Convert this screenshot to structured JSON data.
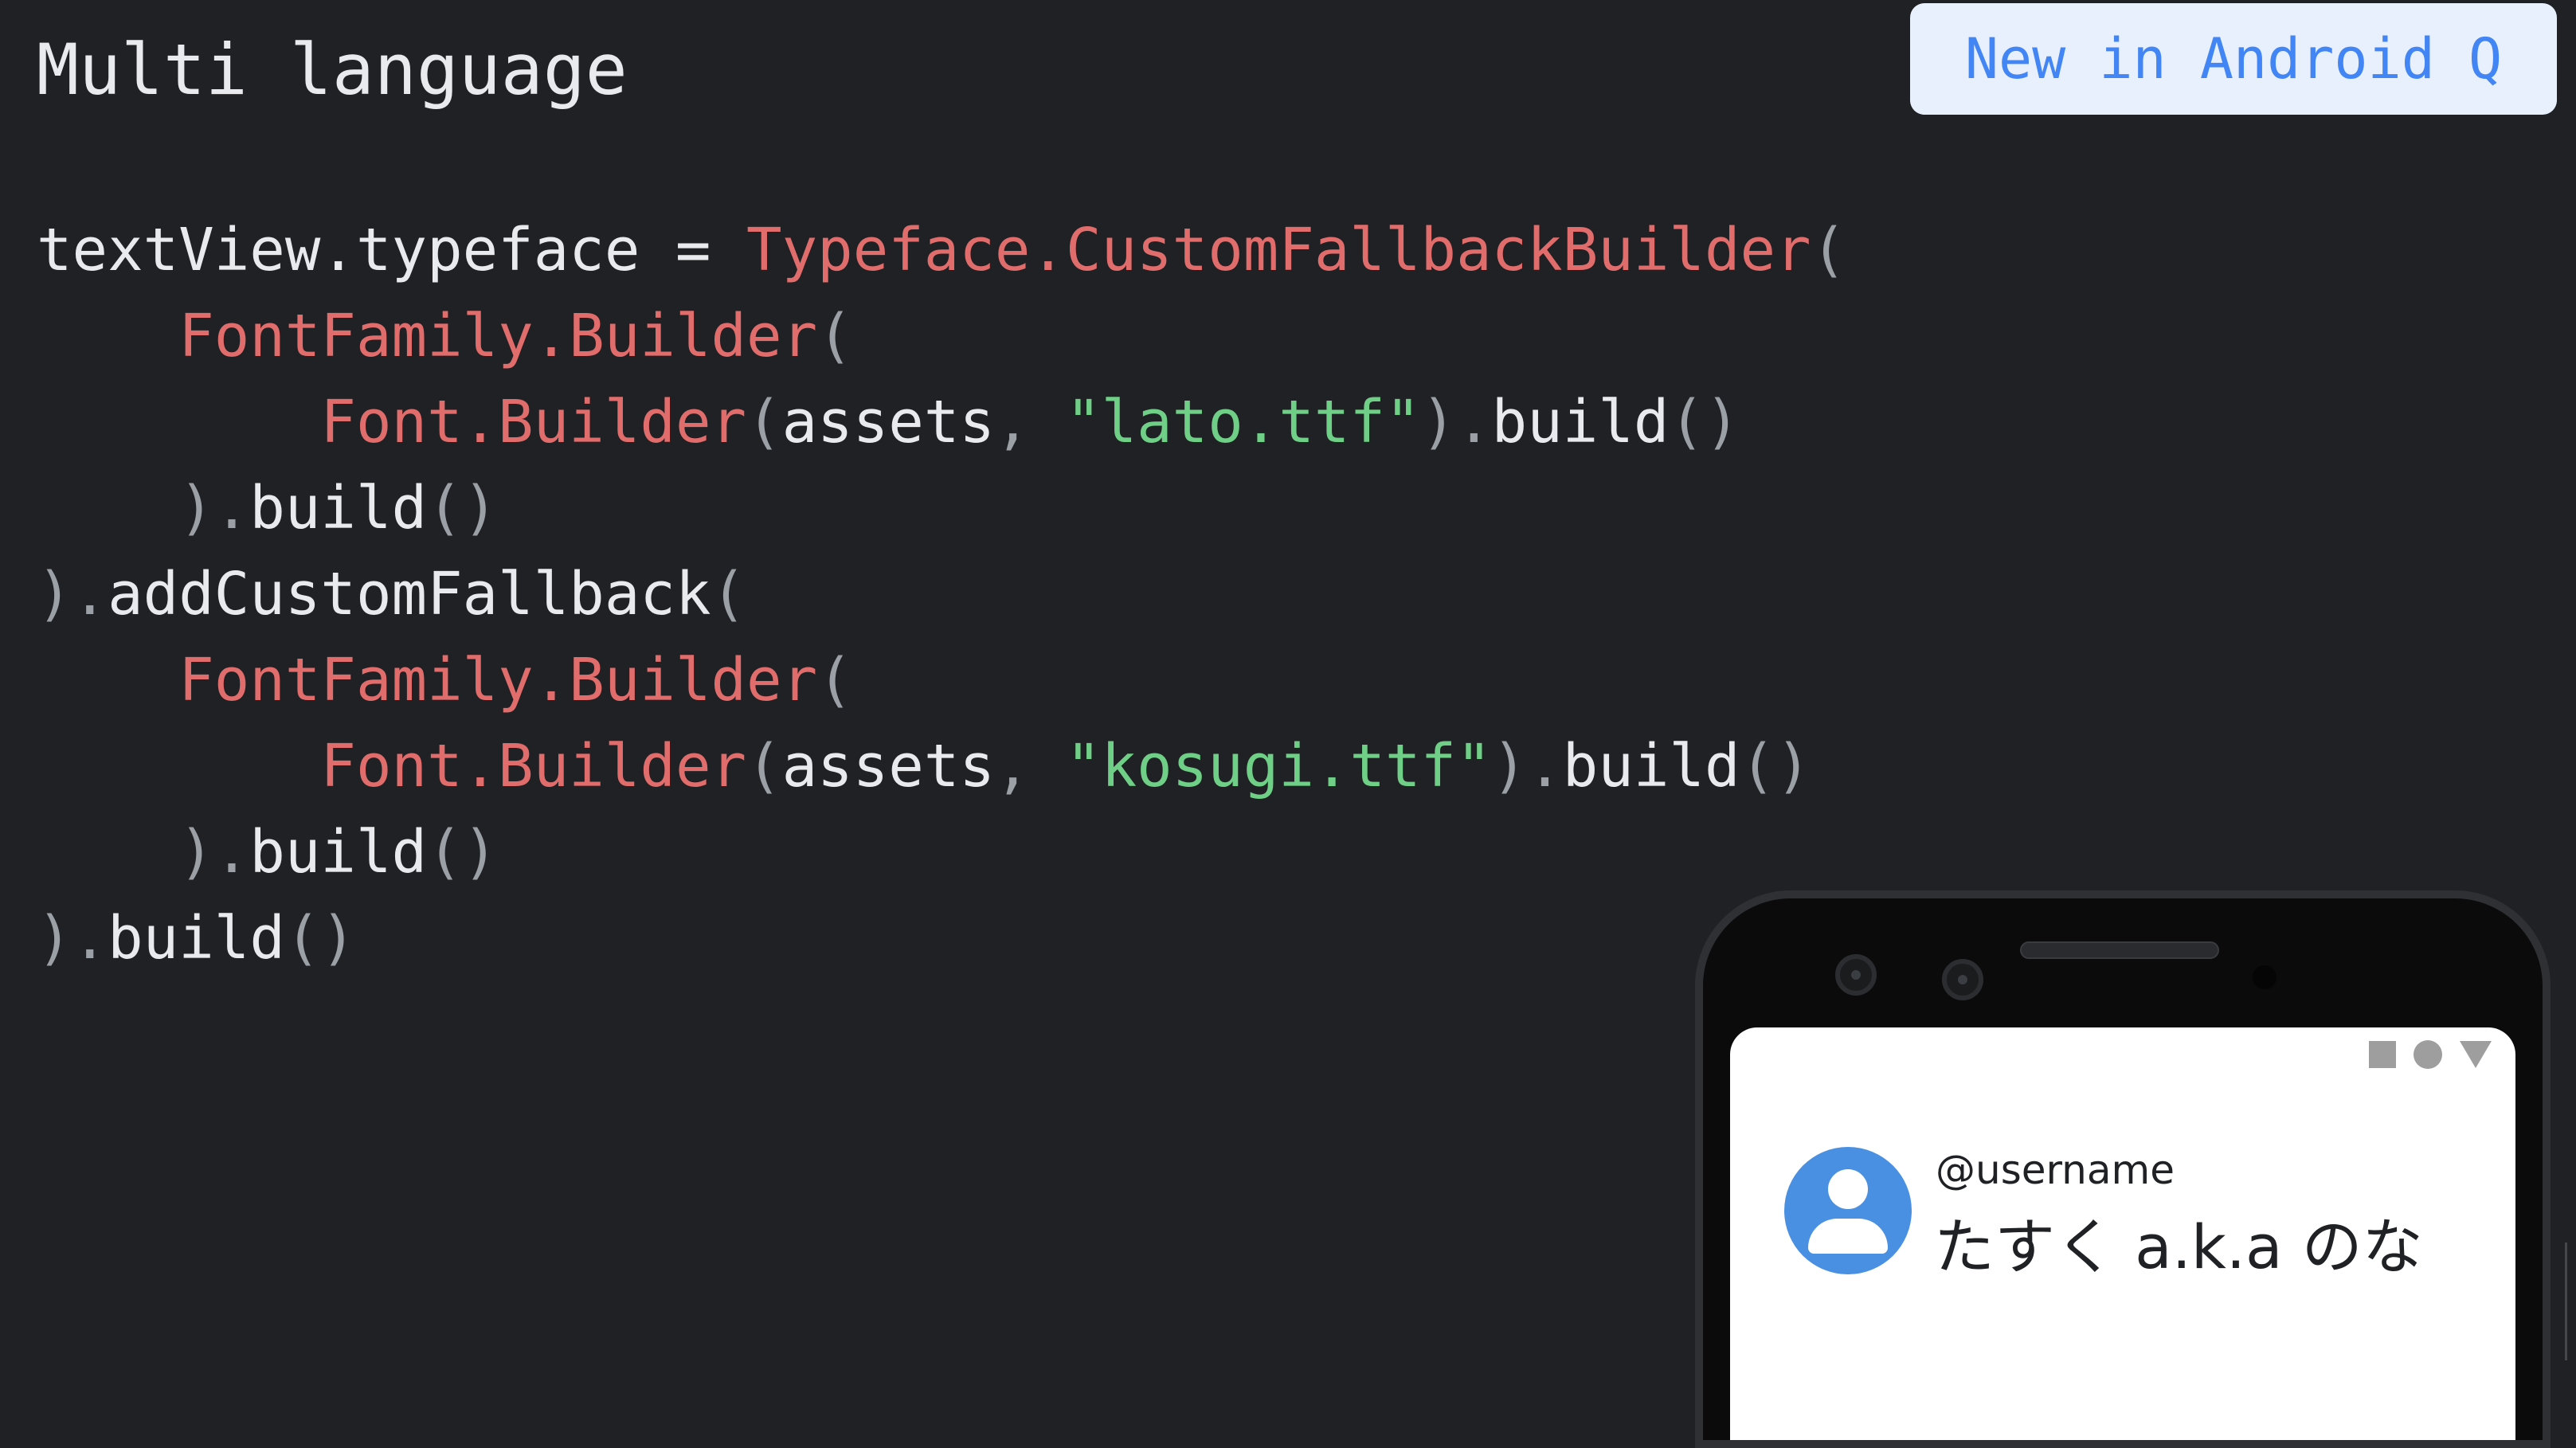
{
  "slide": {
    "title": "Multi language",
    "badge": "New in Android Q"
  },
  "code": {
    "lines": [
      [
        {
          "t": "textView.typeface = ",
          "k": "txt"
        },
        {
          "t": "Typeface.CustomFallbackBuilder",
          "k": "cls"
        },
        {
          "t": "(",
          "k": "pun"
        }
      ],
      [
        {
          "t": "    ",
          "k": "txt"
        },
        {
          "t": "FontFamily.Builder",
          "k": "cls"
        },
        {
          "t": "(",
          "k": "pun"
        }
      ],
      [
        {
          "t": "        ",
          "k": "txt"
        },
        {
          "t": "Font.Builder",
          "k": "cls"
        },
        {
          "t": "(",
          "k": "pun"
        },
        {
          "t": "assets",
          "k": "txt"
        },
        {
          "t": ", ",
          "k": "pun"
        },
        {
          "t": "\"lato.ttf\"",
          "k": "str"
        },
        {
          "t": ").",
          "k": "pun"
        },
        {
          "t": "build",
          "k": "txt"
        },
        {
          "t": "()",
          "k": "pun"
        }
      ],
      [
        {
          "t": "    ",
          "k": "txt"
        },
        {
          "t": ").",
          "k": "pun"
        },
        {
          "t": "build",
          "k": "txt"
        },
        {
          "t": "()",
          "k": "pun"
        }
      ],
      [
        {
          "t": ").",
          "k": "pun"
        },
        {
          "t": "addCustomFallback",
          "k": "txt"
        },
        {
          "t": "(",
          "k": "pun"
        }
      ],
      [
        {
          "t": "    ",
          "k": "txt"
        },
        {
          "t": "FontFamily.Builder",
          "k": "cls"
        },
        {
          "t": "(",
          "k": "pun"
        }
      ],
      [
        {
          "t": "        ",
          "k": "txt"
        },
        {
          "t": "Font.Builder",
          "k": "cls"
        },
        {
          "t": "(",
          "k": "pun"
        },
        {
          "t": "assets",
          "k": "txt"
        },
        {
          "t": ", ",
          "k": "pun"
        },
        {
          "t": "\"kosugi.ttf\"",
          "k": "str"
        },
        {
          "t": ").",
          "k": "pun"
        },
        {
          "t": "build",
          "k": "txt"
        },
        {
          "t": "()",
          "k": "pun"
        }
      ],
      [
        {
          "t": "    ",
          "k": "txt"
        },
        {
          "t": ").",
          "k": "pun"
        },
        {
          "t": "build",
          "k": "txt"
        },
        {
          "t": "()",
          "k": "pun"
        }
      ],
      [
        {
          "t": ").",
          "k": "pun"
        },
        {
          "t": "build",
          "k": "txt"
        },
        {
          "t": "()",
          "k": "pun"
        }
      ]
    ]
  },
  "phone": {
    "status_icons": [
      "square-icon",
      "circle-icon",
      "triangle-icon"
    ],
    "notification": {
      "avatar_icon": "person-icon",
      "username": "@username",
      "display_name": "たすく a.k.a のな"
    }
  },
  "colors": {
    "background": "#202124",
    "text": "#e8eaed",
    "class_name": "#e06c6c",
    "string_literal": "#6fcf86",
    "punctuation": "#9aa0a6",
    "badge_background": "#e8f0fe",
    "badge_text": "#4285f4",
    "avatar": "#4a90e2"
  }
}
